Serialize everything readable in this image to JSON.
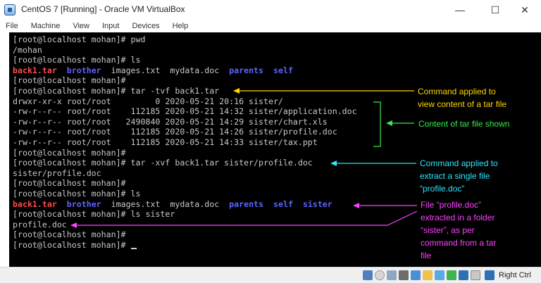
{
  "window": {
    "title": "CentOS 7 [Running] - Oracle VM VirtualBox",
    "minimize": "—",
    "maximize": "☐",
    "close": "✕"
  },
  "menu": [
    "File",
    "Machine",
    "View",
    "Input",
    "Devices",
    "Help"
  ],
  "terminal": {
    "lines": [
      {
        "segments": [
          {
            "text": "[root@localhost mohan]# pwd",
            "color": "normal"
          }
        ]
      },
      {
        "segments": [
          {
            "text": "/mohan",
            "color": "normal"
          }
        ]
      },
      {
        "segments": [
          {
            "text": "[root@localhost mohan]# ls",
            "color": "normal"
          }
        ]
      },
      {
        "segments": [
          {
            "text": "back1.tar",
            "color": "red"
          },
          {
            "text": "  ",
            "color": "normal"
          },
          {
            "text": "brother",
            "color": "blue"
          },
          {
            "text": "  images.txt  mydata.doc  ",
            "color": "normal"
          },
          {
            "text": "parents",
            "color": "blue"
          },
          {
            "text": "  ",
            "color": "normal"
          },
          {
            "text": "self",
            "color": "blue"
          }
        ]
      },
      {
        "segments": [
          {
            "text": "[root@localhost mohan]#",
            "color": "normal"
          }
        ]
      },
      {
        "segments": [
          {
            "text": "[root@localhost mohan]# tar -tvf back1.tar",
            "color": "normal"
          }
        ]
      },
      {
        "segments": [
          {
            "text": "drwxr-xr-x root/root         0 2020-05-21 20:16 sister/",
            "color": "normal"
          }
        ]
      },
      {
        "segments": [
          {
            "text": "-rw-r--r-- root/root    112185 2020-05-21 14:32 sister/application.doc",
            "color": "normal"
          }
        ]
      },
      {
        "segments": [
          {
            "text": "-rw-r--r-- root/root   2490840 2020-05-21 14:29 sister/chart.xls",
            "color": "normal"
          }
        ]
      },
      {
        "segments": [
          {
            "text": "-rw-r--r-- root/root    112185 2020-05-21 14:26 sister/profile.doc",
            "color": "normal"
          }
        ]
      },
      {
        "segments": [
          {
            "text": "-rw-r--r-- root/root    112185 2020-05-21 14:33 sister/tax.ppt",
            "color": "normal"
          }
        ]
      },
      {
        "segments": [
          {
            "text": "[root@localhost mohan]#",
            "color": "normal"
          }
        ]
      },
      {
        "segments": [
          {
            "text": "[root@localhost mohan]# tar -xvf back1.tar sister/profile.doc",
            "color": "normal"
          }
        ]
      },
      {
        "segments": [
          {
            "text": "sister/profile.doc",
            "color": "normal"
          }
        ]
      },
      {
        "segments": [
          {
            "text": "[root@localhost mohan]#",
            "color": "normal"
          }
        ]
      },
      {
        "segments": [
          {
            "text": "[root@localhost mohan]# ls",
            "color": "normal"
          }
        ]
      },
      {
        "segments": [
          {
            "text": "back1.tar",
            "color": "red"
          },
          {
            "text": "  ",
            "color": "normal"
          },
          {
            "text": "brother",
            "color": "blue"
          },
          {
            "text": "  images.txt  mydata.doc  ",
            "color": "normal"
          },
          {
            "text": "parents",
            "color": "blue"
          },
          {
            "text": "  ",
            "color": "normal"
          },
          {
            "text": "self",
            "color": "blue"
          },
          {
            "text": "  ",
            "color": "normal"
          },
          {
            "text": "sister",
            "color": "blue"
          }
        ]
      },
      {
        "segments": [
          {
            "text": "[root@localhost mohan]# ls sister",
            "color": "normal"
          }
        ]
      },
      {
        "segments": [
          {
            "text": "profile.doc",
            "color": "normal"
          }
        ]
      },
      {
        "segments": [
          {
            "text": "[root@localhost mohan]#",
            "color": "normal"
          }
        ]
      },
      {
        "segments": [
          {
            "text": "[root@localhost mohan]# ",
            "color": "normal"
          }
        ],
        "cursor": true
      }
    ]
  },
  "annotations": {
    "view_command": [
      "Command  applied to",
      "view content of a tar file"
    ],
    "content_shown": [
      "Content of tar file shown"
    ],
    "extract_command": [
      "Command  applied to",
      "extract a single file",
      "“profile.doc”"
    ],
    "extracted_file": [
      "File “profile.doc”",
      "extracted in a folder",
      "“sister”, as per",
      "command  from a tar",
      "file"
    ]
  },
  "colors": {
    "terminal_bg": "#000000",
    "terminal_text": "#c8c8c8",
    "archive_red": "#ff4a4a",
    "directory_blue": "#5b64ff",
    "annot_yellow": "#ffd800",
    "annot_green": "#39e84b",
    "annot_cyan": "#2ee6ff",
    "annot_magenta": "#ff40ff"
  },
  "statusbar": {
    "host_key": "Right Ctrl",
    "icons": [
      "optical-drive-icon",
      "audio-icon",
      "network-icon",
      "usb-icon",
      "shared-folders-icon",
      "display-icon",
      "video-capture-icon",
      "vm-icon",
      "cpu-icon",
      "mouse-integration-icon",
      "keyboard-icon"
    ]
  }
}
